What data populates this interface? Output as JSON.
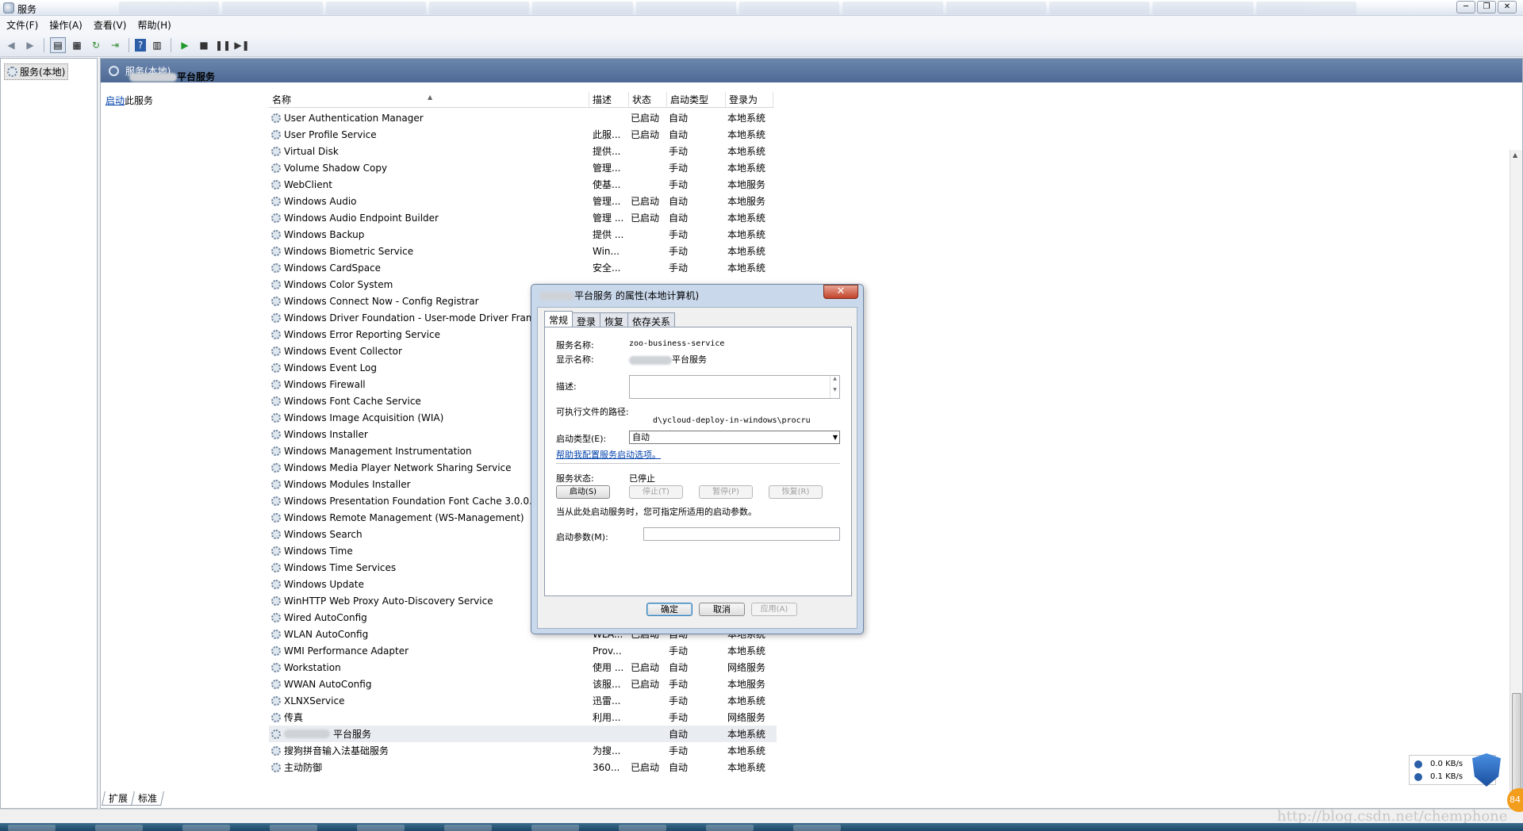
{
  "window": {
    "title": "服务",
    "controls": [
      "─",
      "❐",
      "✕"
    ]
  },
  "menu": [
    "文件(F)",
    "操作(A)",
    "查看(V)",
    "帮助(H)"
  ],
  "tree": {
    "root_label": "服务(本地)"
  },
  "main": {
    "header_label": "服务(本地)",
    "selected_service_title": "平台服务",
    "start_link": "启动",
    "start_link_suffix": "此服务"
  },
  "columns": [
    "名称",
    "描述",
    "状态",
    "启动类型",
    "登录为"
  ],
  "services": [
    {
      "name": "User Authentication Manager",
      "desc": "",
      "state": "已启动",
      "start": "自动",
      "logon": "本地系统"
    },
    {
      "name": "User Profile Service",
      "desc": "此服...",
      "state": "已启动",
      "start": "自动",
      "logon": "本地系统"
    },
    {
      "name": "Virtual Disk",
      "desc": "提供...",
      "state": "",
      "start": "手动",
      "logon": "本地系统"
    },
    {
      "name": "Volume Shadow Copy",
      "desc": "管理...",
      "state": "",
      "start": "手动",
      "logon": "本地系统"
    },
    {
      "name": "WebClient",
      "desc": "使基...",
      "state": "",
      "start": "手动",
      "logon": "本地服务"
    },
    {
      "name": "Windows Audio",
      "desc": "管理...",
      "state": "已启动",
      "start": "自动",
      "logon": "本地服务"
    },
    {
      "name": "Windows Audio Endpoint Builder",
      "desc": "管理 ...",
      "state": "已启动",
      "start": "自动",
      "logon": "本地系统"
    },
    {
      "name": "Windows Backup",
      "desc": "提供 ...",
      "state": "",
      "start": "手动",
      "logon": "本地系统"
    },
    {
      "name": "Windows Biometric Service",
      "desc": "Win...",
      "state": "",
      "start": "手动",
      "logon": "本地系统"
    },
    {
      "name": "Windows CardSpace",
      "desc": "安全...",
      "state": "",
      "start": "手动",
      "logon": "本地系统"
    },
    {
      "name": "Windows Color System",
      "desc": "",
      "state": "",
      "start": "",
      "logon": ""
    },
    {
      "name": "Windows Connect Now - Config Registrar",
      "desc": "",
      "state": "",
      "start": "",
      "logon": ""
    },
    {
      "name": "Windows Driver Foundation - User-mode Driver Fram",
      "desc": "",
      "state": "",
      "start": "",
      "logon": ""
    },
    {
      "name": "Windows Error Reporting Service",
      "desc": "",
      "state": "",
      "start": "",
      "logon": ""
    },
    {
      "name": "Windows Event Collector",
      "desc": "",
      "state": "",
      "start": "",
      "logon": ""
    },
    {
      "name": "Windows Event Log",
      "desc": "",
      "state": "",
      "start": "",
      "logon": ""
    },
    {
      "name": "Windows Firewall",
      "desc": "",
      "state": "",
      "start": "",
      "logon": ""
    },
    {
      "name": "Windows Font Cache Service",
      "desc": "",
      "state": "",
      "start": "",
      "logon": ""
    },
    {
      "name": "Windows Image Acquisition (WIA)",
      "desc": "",
      "state": "",
      "start": "",
      "logon": ""
    },
    {
      "name": "Windows Installer",
      "desc": "",
      "state": "",
      "start": "",
      "logon": ""
    },
    {
      "name": "Windows Management Instrumentation",
      "desc": "",
      "state": "",
      "start": "",
      "logon": ""
    },
    {
      "name": "Windows Media Player Network Sharing Service",
      "desc": "",
      "state": "",
      "start": "",
      "logon": ""
    },
    {
      "name": "Windows Modules Installer",
      "desc": "",
      "state": "",
      "start": "",
      "logon": ""
    },
    {
      "name": "Windows Presentation Foundation Font Cache 3.0.0.0",
      "desc": "",
      "state": "",
      "start": "",
      "logon": ""
    },
    {
      "name": "Windows Remote Management (WS-Management)",
      "desc": "",
      "state": "",
      "start": "",
      "logon": ""
    },
    {
      "name": "Windows Search",
      "desc": "",
      "state": "",
      "start": "",
      "logon": ""
    },
    {
      "name": "Windows Time",
      "desc": "",
      "state": "",
      "start": "",
      "logon": ""
    },
    {
      "name": "Windows Time Services",
      "desc": "",
      "state": "",
      "start": "",
      "logon": ""
    },
    {
      "name": "Windows Update",
      "desc": "",
      "state": "",
      "start": "",
      "logon": ""
    },
    {
      "name": "WinHTTP Web Proxy Auto-Discovery Service",
      "desc": "",
      "state": "",
      "start": "",
      "logon": ""
    },
    {
      "name": "Wired AutoConfig",
      "desc": "",
      "state": "",
      "start": "",
      "logon": ""
    },
    {
      "name": "WLAN AutoConfig",
      "desc": "WLA...",
      "state": "已启动",
      "start": "自动",
      "logon": "本地系统"
    },
    {
      "name": "WMI Performance Adapter",
      "desc": "Prov...",
      "state": "",
      "start": "手动",
      "logon": "本地系统"
    },
    {
      "name": "Workstation",
      "desc": "使用 ...",
      "state": "已启动",
      "start": "自动",
      "logon": "网络服务"
    },
    {
      "name": "WWAN AutoConfig",
      "desc": "该服...",
      "state": "已启动",
      "start": "手动",
      "logon": "本地服务"
    },
    {
      "name": "XLNXService",
      "desc": "迅雷...",
      "state": "",
      "start": "手动",
      "logon": "本地系统"
    },
    {
      "name": "传真",
      "desc": "利用...",
      "state": "",
      "start": "手动",
      "logon": "网络服务"
    },
    {
      "name": "平台服务",
      "desc": "",
      "state": "",
      "start": "自动",
      "logon": "本地系统",
      "selected": true,
      "blurred_prefix": true
    },
    {
      "name": "搜狗拼音输入法基础服务",
      "desc": "为搜...",
      "state": "",
      "start": "手动",
      "logon": "本地系统"
    },
    {
      "name": "主动防御",
      "desc": "360...",
      "state": "已启动",
      "start": "自动",
      "logon": "本地系统"
    }
  ],
  "bottom_tabs": [
    "扩展",
    "标准"
  ],
  "dialog": {
    "title_suffix": "平台服务 的属性(本地计算机)",
    "tabs": [
      "常规",
      "登录",
      "恢复",
      "依存关系"
    ],
    "service_name_label": "服务名称:",
    "service_name_value": "zoo-business-service",
    "display_name_label": "显示名称:",
    "display_name_value": "平台服务",
    "desc_label": "描述:",
    "exe_path_label": "可执行文件的路径:",
    "exe_path_value": "d\\ycloud-deploy-in-windows\\procru",
    "startup_type_label": "启动类型(E):",
    "startup_type_value": "自动",
    "help_link": "帮助我配置服务启动选项。",
    "status_label": "服务状态:",
    "status_value": "已停止",
    "buttons": {
      "start": "启动(S)",
      "stop": "停止(T)",
      "pause": "暂停(P)",
      "resume": "恢复(R)"
    },
    "hint": "当从此处启动服务时，您可指定所适用的启动参数。",
    "params_label": "启动参数(M):",
    "ok": "确定",
    "cancel": "取消",
    "apply": "应用(A)"
  },
  "network_widget": {
    "down": "0.0 KB/s",
    "up": "0.1 KB/s"
  },
  "orange_badge": "84",
  "watermark": "http://blog.csdn.net/chemphone"
}
